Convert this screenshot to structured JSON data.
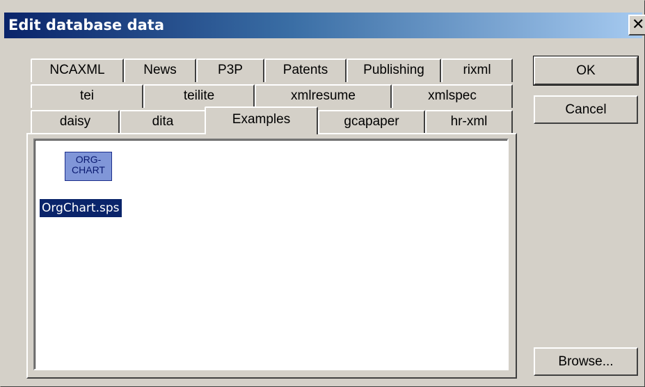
{
  "window": {
    "title": "Edit database data",
    "close_glyph": "✕"
  },
  "tabs": {
    "row1": [
      "NCAXML",
      "News",
      "P3P",
      "Patents",
      "Publishing",
      "rixml"
    ],
    "row2": [
      "tei",
      "teilite",
      "xmlresume",
      "xmlspec"
    ],
    "row3": [
      "daisy",
      "dita",
      "Examples",
      "gcapaper",
      "hr-xml"
    ],
    "selected": "Examples"
  },
  "listview": {
    "items": [
      {
        "icon": "org-chart-icon",
        "icon_text": "ORG-\nCHART",
        "label": "OrgChart.sps",
        "selected": true
      }
    ]
  },
  "buttons": {
    "ok": "OK",
    "cancel": "Cancel",
    "browse": "Browse..."
  },
  "colors": {
    "dialog_face": "#d4d0c8",
    "title_gradient_start": "#0a246a",
    "title_gradient_end": "#a6caf0",
    "selection": "#0a246a",
    "icon_fill": "#8096d8"
  }
}
